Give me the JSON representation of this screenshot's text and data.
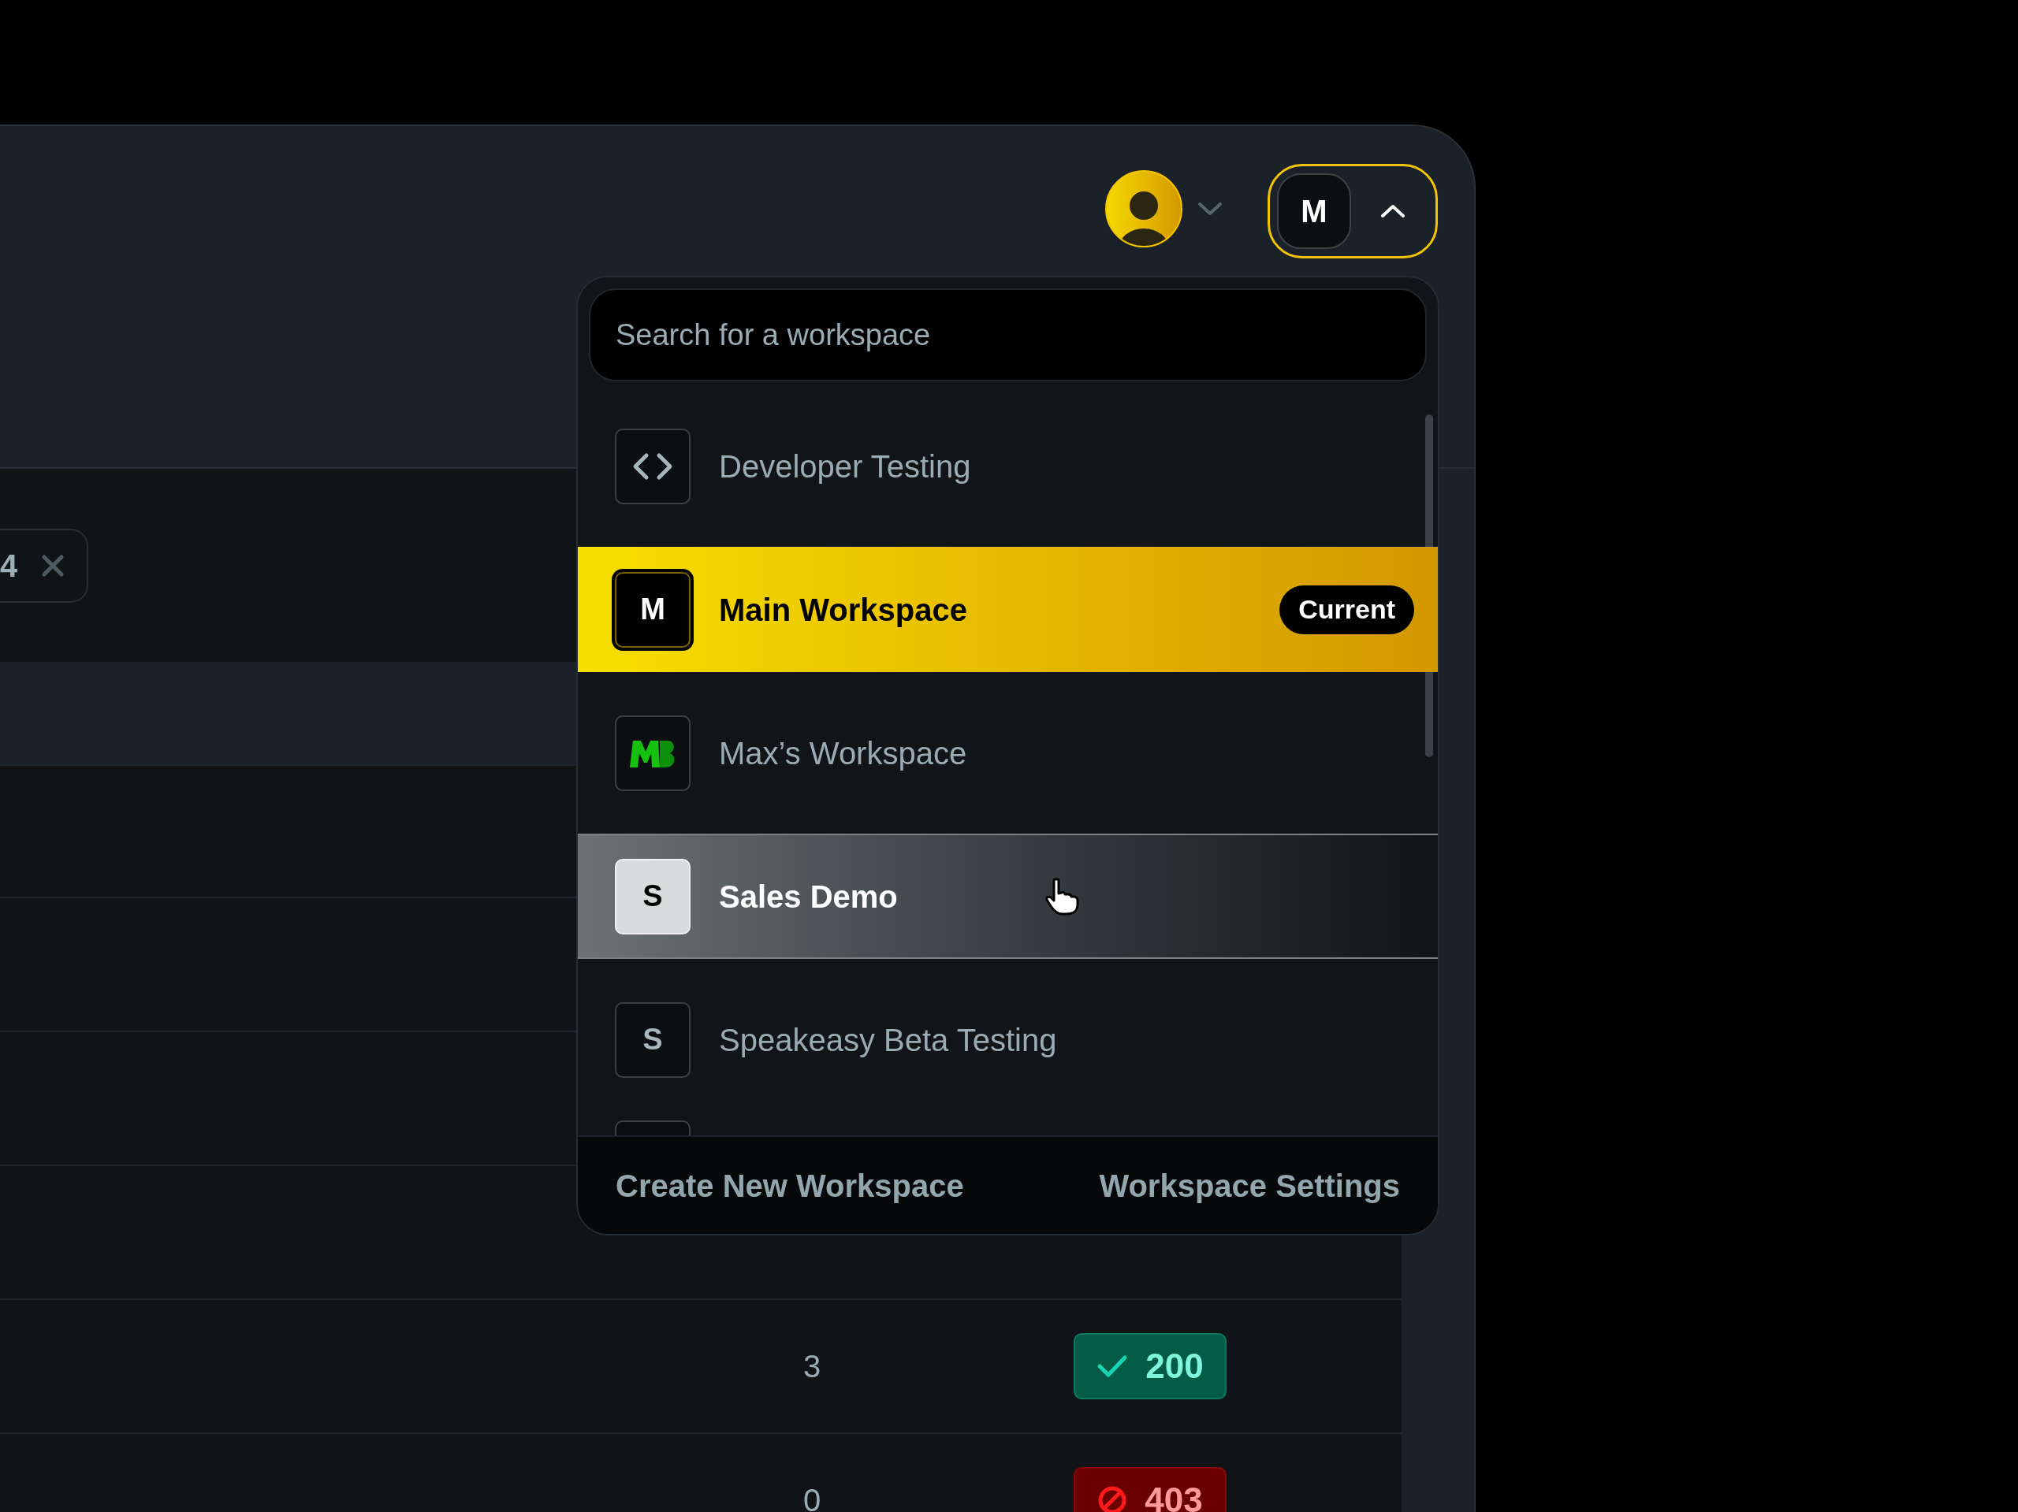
{
  "header": {
    "workspace_button": {
      "initial": "M",
      "expanded": true
    }
  },
  "filter_chip": {
    "label": "4"
  },
  "workspace_menu": {
    "search": {
      "placeholder": "Search for a workspace"
    },
    "items": [
      {
        "name": "Developer Testing",
        "icon": {
          "kind": "code"
        },
        "selected": false,
        "hovered": false
      },
      {
        "name": "Main Workspace",
        "icon": {
          "kind": "letter",
          "letter": "M"
        },
        "selected": true,
        "hovered": false,
        "badge": "Current"
      },
      {
        "name": "Max’s Workspace",
        "icon": {
          "kind": "logo"
        },
        "selected": false,
        "hovered": false
      },
      {
        "name": "Sales Demo",
        "icon": {
          "kind": "letter",
          "letter": "S"
        },
        "selected": false,
        "hovered": true
      },
      {
        "name": "Speakeasy Beta Testing",
        "icon": {
          "kind": "letter",
          "letter": "S"
        },
        "selected": false,
        "hovered": false
      }
    ],
    "footer": {
      "create": "Create New Workspace",
      "settings": "Workspace Settings"
    }
  },
  "table": {
    "rows": [
      {
        "count": "3",
        "status": {
          "kind": "ok",
          "code": "200"
        }
      },
      {
        "count": "0",
        "status": {
          "kind": "blocked",
          "code": "403"
        }
      }
    ]
  }
}
